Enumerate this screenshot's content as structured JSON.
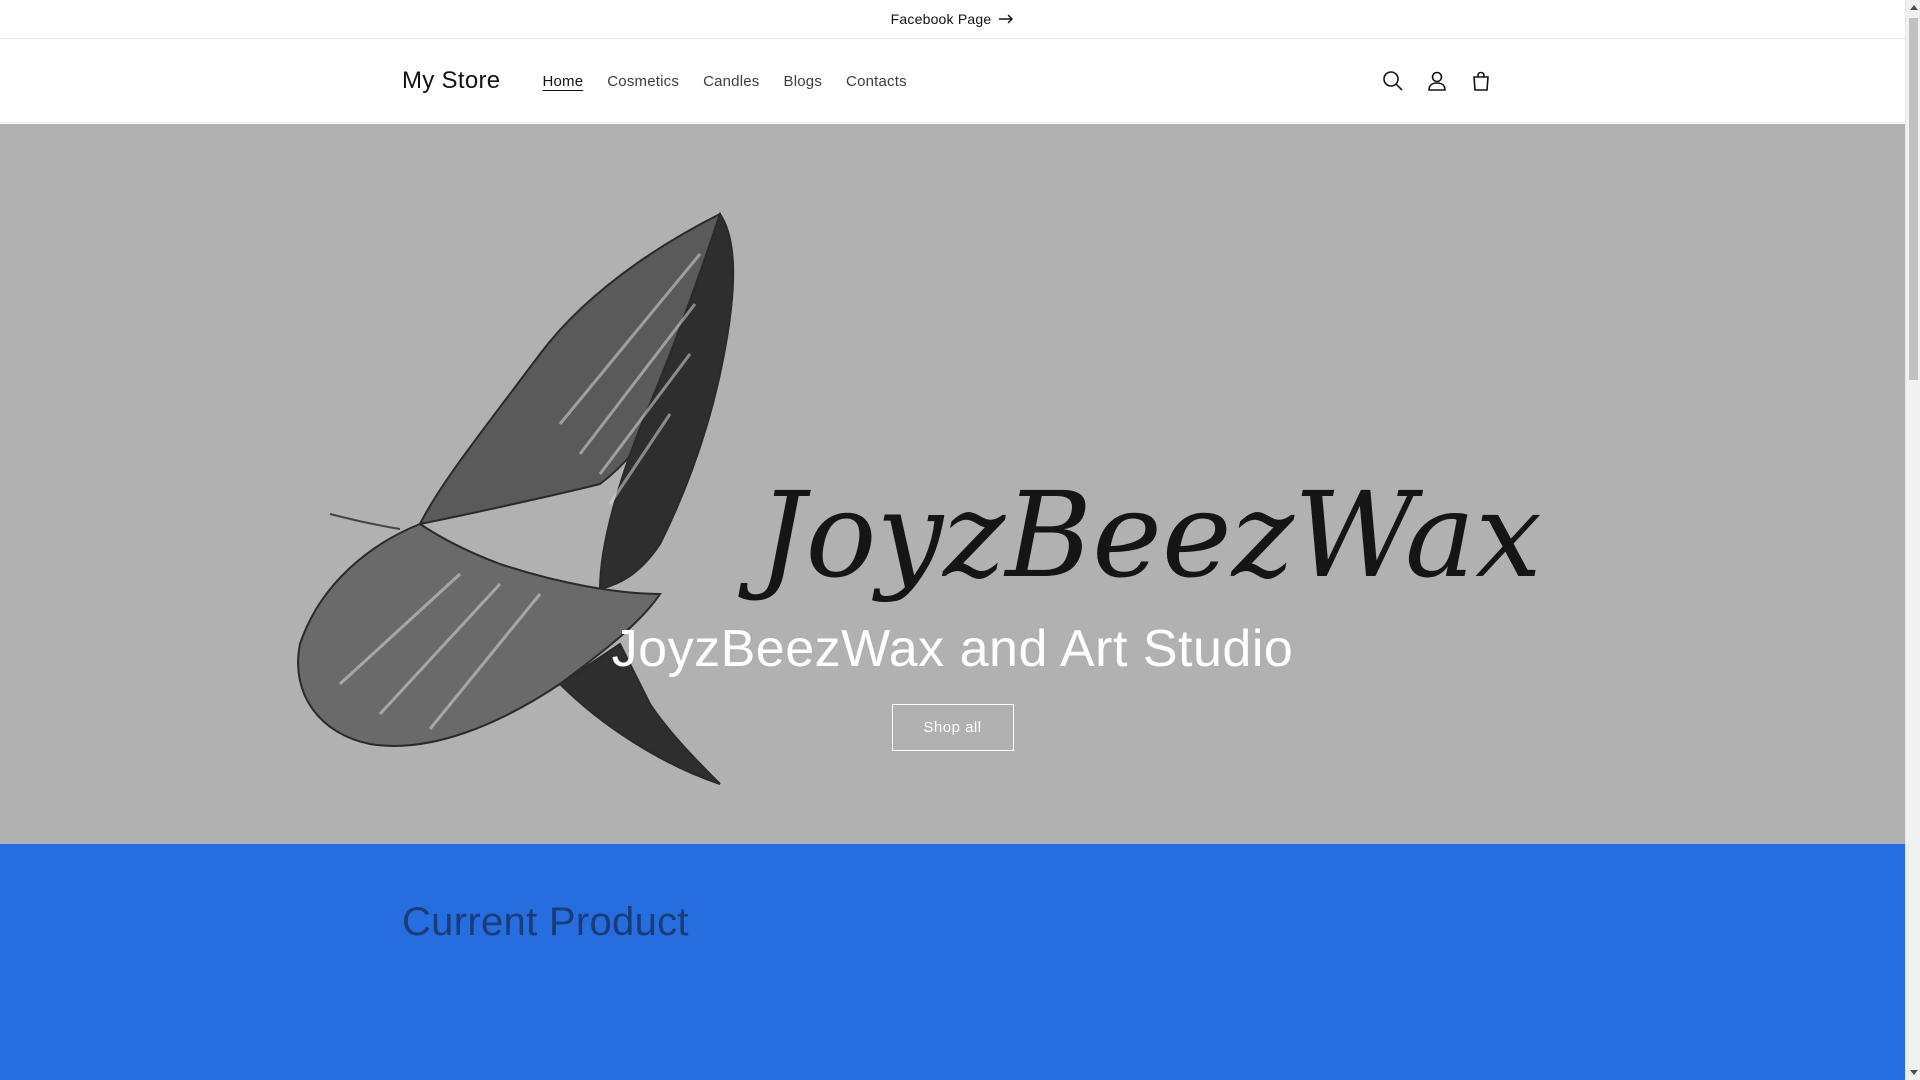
{
  "announcement": {
    "text": "Facebook Page",
    "icon": "arrow-right-icon"
  },
  "header": {
    "logo": "My Store",
    "nav": [
      {
        "label": "Home",
        "active": true
      },
      {
        "label": "Cosmetics",
        "active": false
      },
      {
        "label": "Candles",
        "active": false
      },
      {
        "label": "Blogs",
        "active": false
      },
      {
        "label": "Contacts",
        "active": false
      }
    ],
    "icons": [
      "search-icon",
      "account-icon",
      "cart-icon"
    ]
  },
  "hero": {
    "image_text": "JoyzBeezWax",
    "title": "JoyzBeezWax and Art Studio",
    "button_label": "Shop all",
    "background_color": "#b1b1b1"
  },
  "product_section": {
    "title": "Current Product",
    "background_color": "#266ddf"
  }
}
